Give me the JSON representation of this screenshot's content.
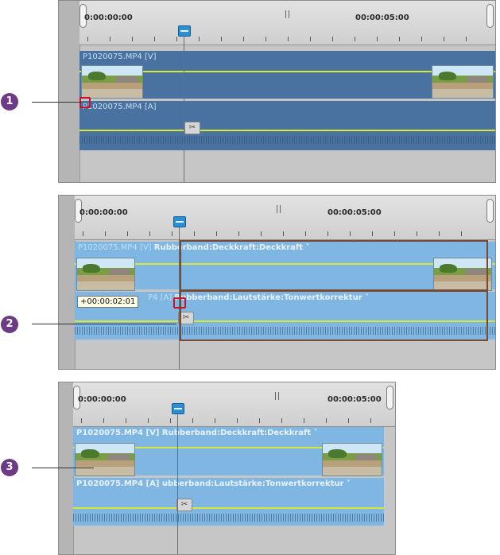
{
  "panels": [
    {
      "timecode_start": "0:00:00:00",
      "timecode_mid": "00:00:05:00",
      "video_track_label": "P1020075.MP4 [V]",
      "audio_track_label": "P1020075.MP4 [A]",
      "callout": "1"
    },
    {
      "timecode_start": "0:00:00:00",
      "timecode_mid": "00:00:05:00",
      "video_track_label": "P1020075.MP4 [V]",
      "video_effect_label": "Rubberband:Deckkraft:Deckkraft ˅",
      "audio_track_label": "P4 [A]",
      "audio_effect_label": "Rubberband:Lautstärke:Tonwertkorrektur ˅",
      "tooltip": "+00:00:02:01",
      "callout": "2"
    },
    {
      "timecode_start": "0:00:00:00",
      "timecode_mid": "00:00:05:00",
      "video_track_label": "P1020075.MP4 [V] Rubberband:Deckkraft:Deckkraft ˅",
      "audio_track_label": "P1020075.MP4 [A] ubberband:Lautstärke:Tonwertkorrektur ˅",
      "callout": "3"
    }
  ],
  "colors": {
    "callout": "#6c3a86",
    "track_dark": "#4a72a0",
    "track_light": "#7fb6e2",
    "playhead": "#e43a3a",
    "envelope": "#d8e838"
  }
}
